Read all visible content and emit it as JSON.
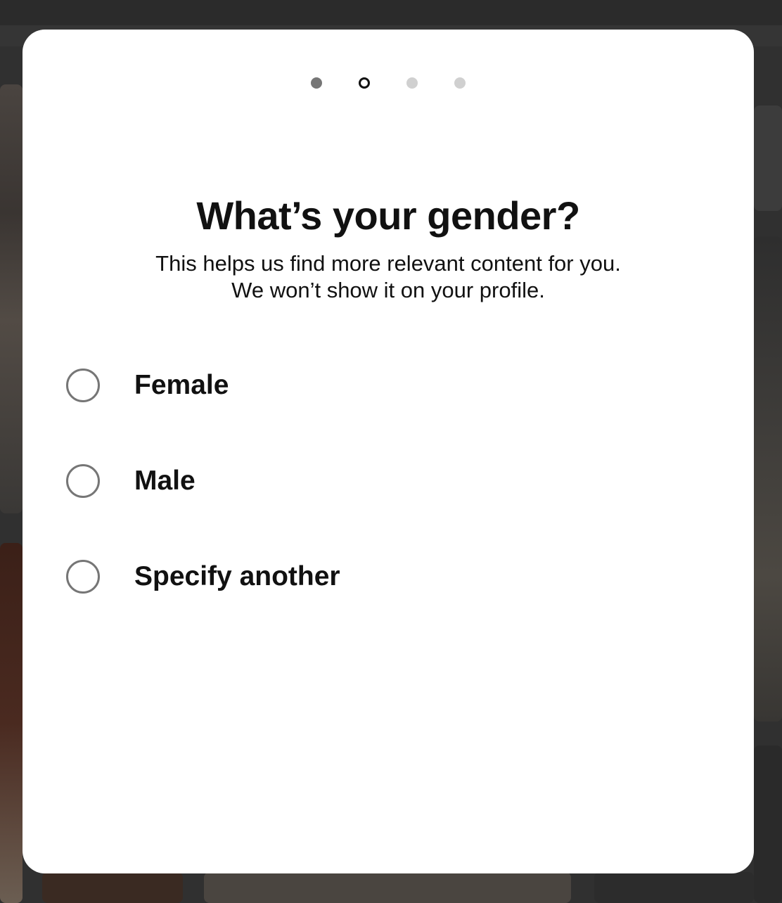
{
  "pager": {
    "steps": [
      {
        "state": "done"
      },
      {
        "state": "current"
      },
      {
        "state": "todo"
      },
      {
        "state": "todo"
      }
    ]
  },
  "dialog": {
    "title": "What’s your gender?",
    "subtitle": "This helps us find more relevant content for you. We won’t show it on your profile."
  },
  "options": [
    {
      "label": "Female",
      "selected": false
    },
    {
      "label": "Male",
      "selected": false
    },
    {
      "label": "Specify another",
      "selected": false
    }
  ],
  "colors": {
    "backdrop": "#2e2e2e",
    "modal": "#ffffff",
    "text": "#111111",
    "radio_border": "#767676",
    "dot_done": "#767676",
    "dot_todo": "#d0d0d0"
  }
}
